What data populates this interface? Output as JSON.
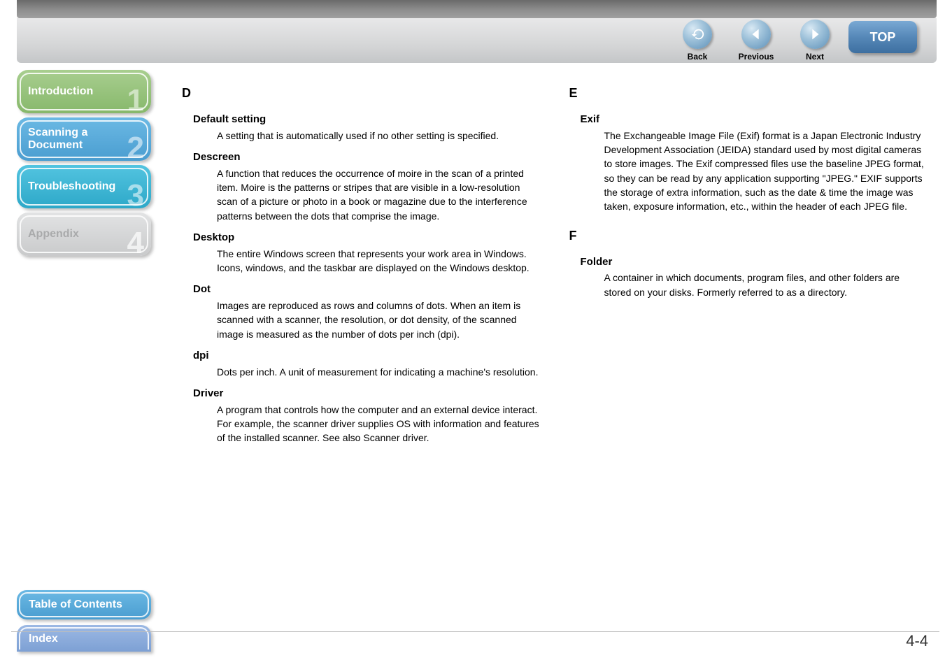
{
  "header": {
    "back": "Back",
    "previous": "Previous",
    "next": "Next",
    "top": "TOP"
  },
  "sidebar": {
    "items": [
      {
        "label": "Introduction",
        "number": "1"
      },
      {
        "label": "Scanning a\nDocument",
        "number": "2"
      },
      {
        "label": "Troubleshooting",
        "number": "3"
      },
      {
        "label": "Appendix",
        "number": "4"
      }
    ]
  },
  "bottom": {
    "toc": "Table of Contents",
    "index": "Index"
  },
  "page_number": "4-4",
  "left_column": {
    "letter": "D",
    "entries": [
      {
        "term": "Default setting",
        "def": "A setting that is automatically used if no other setting is specified."
      },
      {
        "term": "Descreen",
        "def": "A function that reduces the occurrence of moire in the scan of a printed item. Moire is the patterns or stripes that are visible in a low-resolution scan of a picture or photo in a book or magazine due to the interference patterns between the dots that comprise the image."
      },
      {
        "term": "Desktop",
        "def": "The entire Windows screen that represents your work area in Windows. Icons, windows, and the taskbar are displayed on the Windows desktop."
      },
      {
        "term": "Dot",
        "def": "Images are reproduced as rows and columns of dots. When an item is scanned with a scanner, the resolution, or dot density, of the scanned image is measured as the number of dots per inch (dpi)."
      },
      {
        "term": "dpi",
        "def": "Dots per inch. A unit of measurement for indicating a machine's resolution."
      },
      {
        "term": "Driver",
        "def": "A program that controls how the computer and an external device interact. For example, the scanner driver supplies OS with information and features of the installed scanner. See also Scanner driver."
      }
    ]
  },
  "right_column": {
    "blocks": [
      {
        "letter": "E",
        "entries": [
          {
            "term": "Exif",
            "def": "The Exchangeable Image File (Exif) format is a Japan Electronic Industry Development Association (JEIDA) standard used by most digital cameras to store images. The Exif compressed files use the baseline JPEG format, so they can be read by any application supporting \"JPEG.\" EXIF supports the storage of extra information, such as the date & time the image was taken, exposure information, etc., within the header of each JPEG file."
          }
        ]
      },
      {
        "letter": "F",
        "entries": [
          {
            "term": "Folder",
            "def": "A container in which documents, program files, and other folders are stored on your disks. Formerly referred to as a directory."
          }
        ]
      }
    ]
  }
}
